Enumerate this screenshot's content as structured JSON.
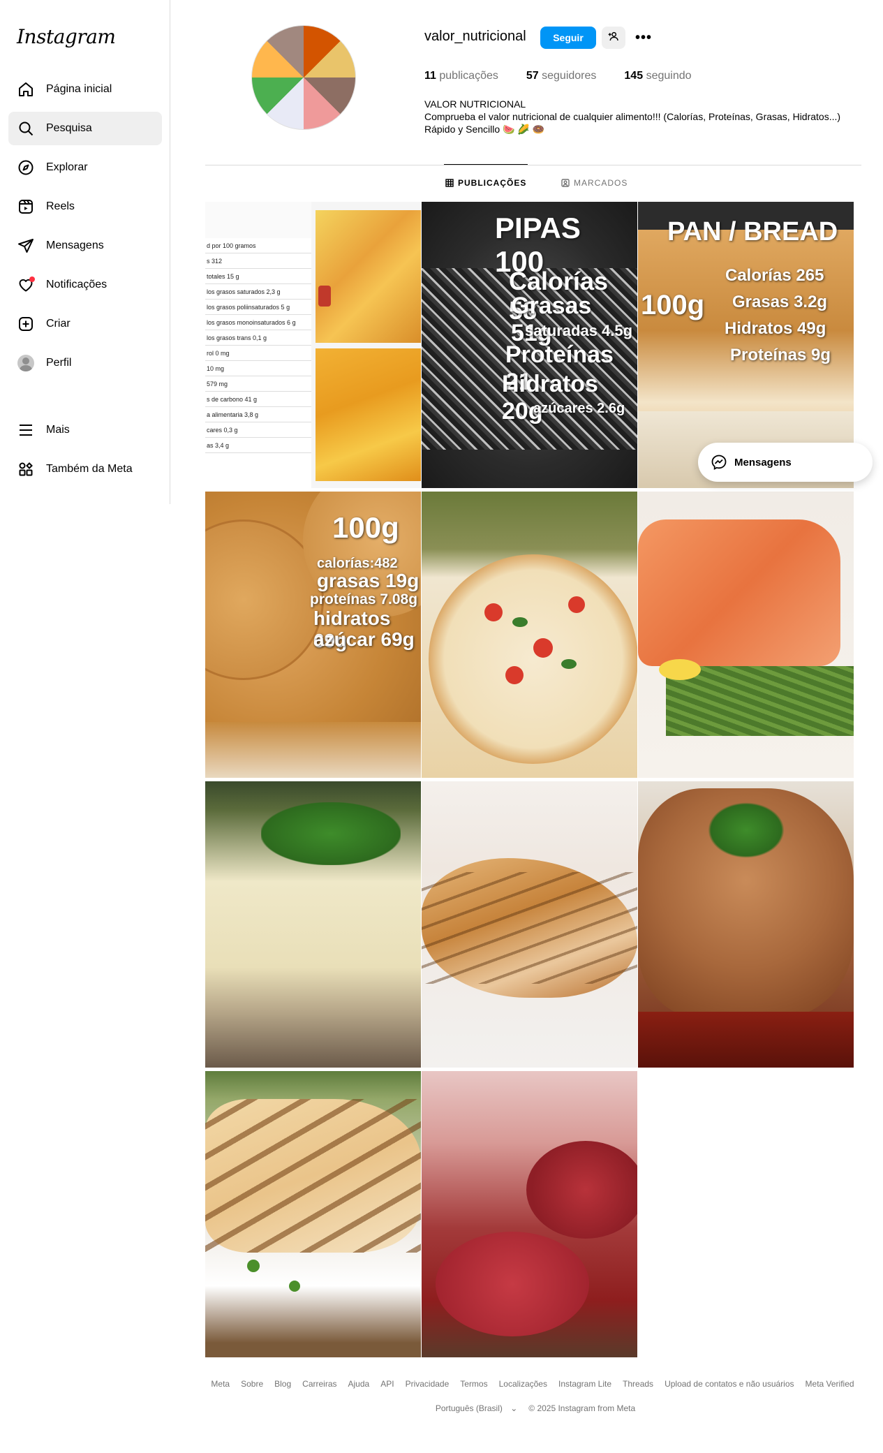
{
  "brand": {
    "logo_text": "Instagram"
  },
  "sidebar": {
    "items": [
      {
        "label": "Página inicial",
        "icon": "home-icon"
      },
      {
        "label": "Pesquisa",
        "icon": "search-icon",
        "active": true
      },
      {
        "label": "Explorar",
        "icon": "compass-icon"
      },
      {
        "label": "Reels",
        "icon": "reels-icon"
      },
      {
        "label": "Mensagens",
        "icon": "send-icon"
      },
      {
        "label": "Notificações",
        "icon": "heart-icon"
      },
      {
        "label": "Criar",
        "icon": "plus-square-icon"
      },
      {
        "label": "Perfil",
        "icon": "avatar-icon"
      }
    ],
    "bottom_items": [
      {
        "label": "Mais",
        "icon": "menu-icon"
      },
      {
        "label": "Também da Meta",
        "icon": "meta-apps-icon"
      }
    ]
  },
  "profile": {
    "username": "valor_nutricional",
    "follow_label": "Seguir",
    "posts_count": "11",
    "posts_label": "publicações",
    "followers_count": "57",
    "followers_label": "seguidores",
    "following_count": "145",
    "following_label": "seguindo",
    "bio_name": "VALOR NUTRICIONAL",
    "bio_line1": "Comprueba el valor nutricional de cualquier alimento!!! (Calorías, Proteínas, Grasas, Hidratos...)",
    "bio_line2": "Rápido y Sencillo 🍉 🌽 🍩"
  },
  "tabs": {
    "posts": "PUBLICAÇÕES",
    "tagged": "MARCADOS"
  },
  "posts": {
    "pipas_title": "PIPAS 100",
    "pipas_lines": [
      "Calorías 58",
      "Grasas 51g",
      "saturadas 4.5g",
      "Proteínas 21",
      "Hidratos 20g",
      "azúcares 2.6g"
    ],
    "pan_title": "PAN / BREAD",
    "pan_100": "100g",
    "pan_lines": [
      "Calorías 265",
      "Grasas 3.2g",
      "Hidratos 49g",
      "Proteínas 9g"
    ],
    "galleta_100": "100g",
    "galleta_lines": [
      "calorías:482",
      "grasas 19g",
      "proteínas 7.08g",
      "hidratos 69g",
      "azúcar 69g"
    ],
    "label_rows": [
      "d por 100 gramos",
      "s 312",
      "totales 15 g",
      "los grasos saturados 2,3 g",
      "los grasos poliinsaturados 5 g",
      "los grasos monoinsaturados 6 g",
      "los grasos trans 0,1 g",
      "rol 0 mg",
      "10 mg",
      "579 mg",
      "s de carbono 41 g",
      "a alimentaria 3,8 g",
      "cares 0,3 g",
      "as 3,4 g"
    ]
  },
  "messages_pill": {
    "label": "Mensagens"
  },
  "footer": {
    "links": [
      "Meta",
      "Sobre",
      "Blog",
      "Carreiras",
      "Ajuda",
      "API",
      "Privacidade",
      "Termos",
      "Localizações",
      "Instagram Lite",
      "Threads",
      "Upload de contatos e não usuários",
      "Meta Verified"
    ],
    "language": "Português (Brasil)",
    "copyright": "© 2025 Instagram from Meta"
  },
  "colors": {
    "accent": "#0095f6",
    "notification": "#ff3040"
  }
}
